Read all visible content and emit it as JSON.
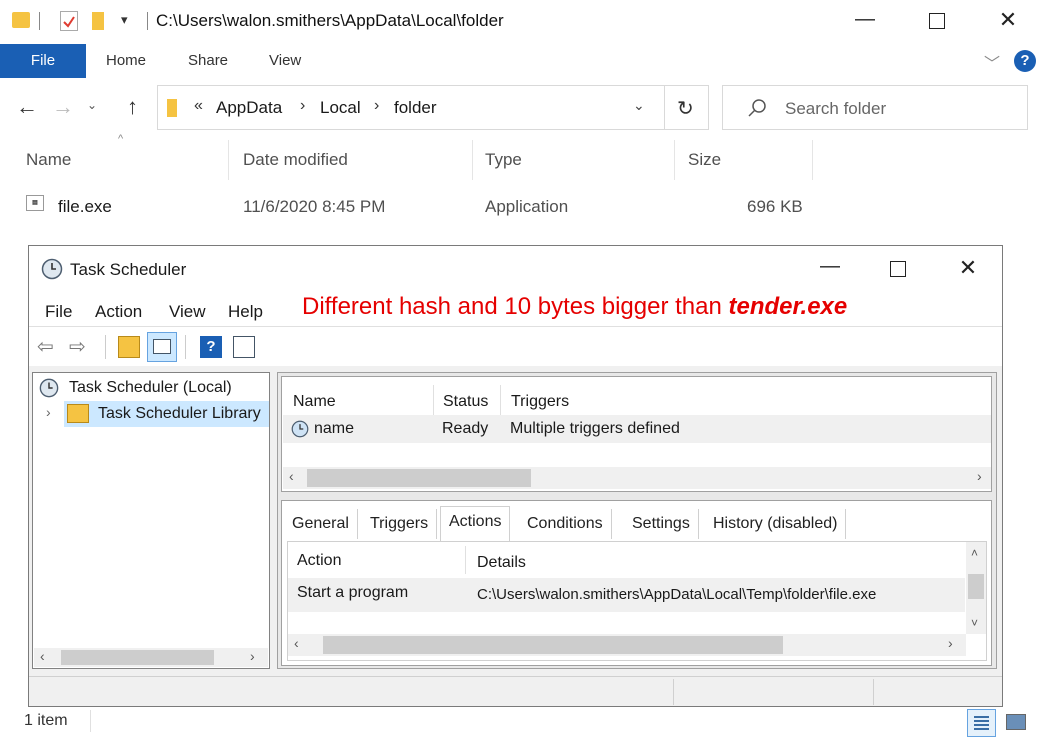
{
  "explorer": {
    "titlebar_path": "C:\\Users\\walon.smithers\\AppData\\Local\\folder",
    "ribbon_tabs": [
      "File",
      "Home",
      "Share",
      "View"
    ],
    "breadcrumb": {
      "overflow": "«",
      "items": [
        "AppData",
        "Local",
        "folder"
      ]
    },
    "search_placeholder": "Search folder",
    "columns": [
      "Name",
      "Date modified",
      "Type",
      "Size"
    ],
    "files": [
      {
        "name": "file.exe",
        "date": "11/6/2020 8:45 PM",
        "type": "Application",
        "size": "696 KB"
      }
    ],
    "status": "1 item"
  },
  "annotation": {
    "prefix": "Different hash and 10 bytes bigger than ",
    "filename": "tender.exe",
    "color": "#e50000"
  },
  "task_scheduler": {
    "title": "Task Scheduler",
    "menu": [
      "File",
      "Action",
      "View",
      "Help"
    ],
    "tree": [
      "Task Scheduler (Local)",
      "Task Scheduler Library"
    ],
    "task_columns": [
      "Name",
      "Status",
      "Triggers"
    ],
    "tasks": [
      {
        "name": "name",
        "status": "Ready",
        "triggers": "Multiple triggers defined"
      }
    ],
    "tabs": [
      "General",
      "Triggers",
      "Actions",
      "Conditions",
      "Settings",
      "History (disabled)"
    ],
    "active_tab": "Actions",
    "action_columns": [
      "Action",
      "Details"
    ],
    "actions": [
      {
        "action": "Start a program",
        "details": "C:\\Users\\walon.smithers\\AppData\\Local\\Temp\\folder\\file.exe"
      }
    ]
  },
  "icons": [
    "folder-icon",
    "checkmark-icon",
    "back-arrow-icon",
    "forward-arrow-icon",
    "up-arrow-icon",
    "refresh-icon",
    "search-icon",
    "help-icon",
    "clock-icon",
    "details-view-icon",
    "large-icons-view-icon"
  ],
  "colors": {
    "accent": "#1a5fb4",
    "folder": "#f5c342",
    "selection": "#cce8ff"
  }
}
